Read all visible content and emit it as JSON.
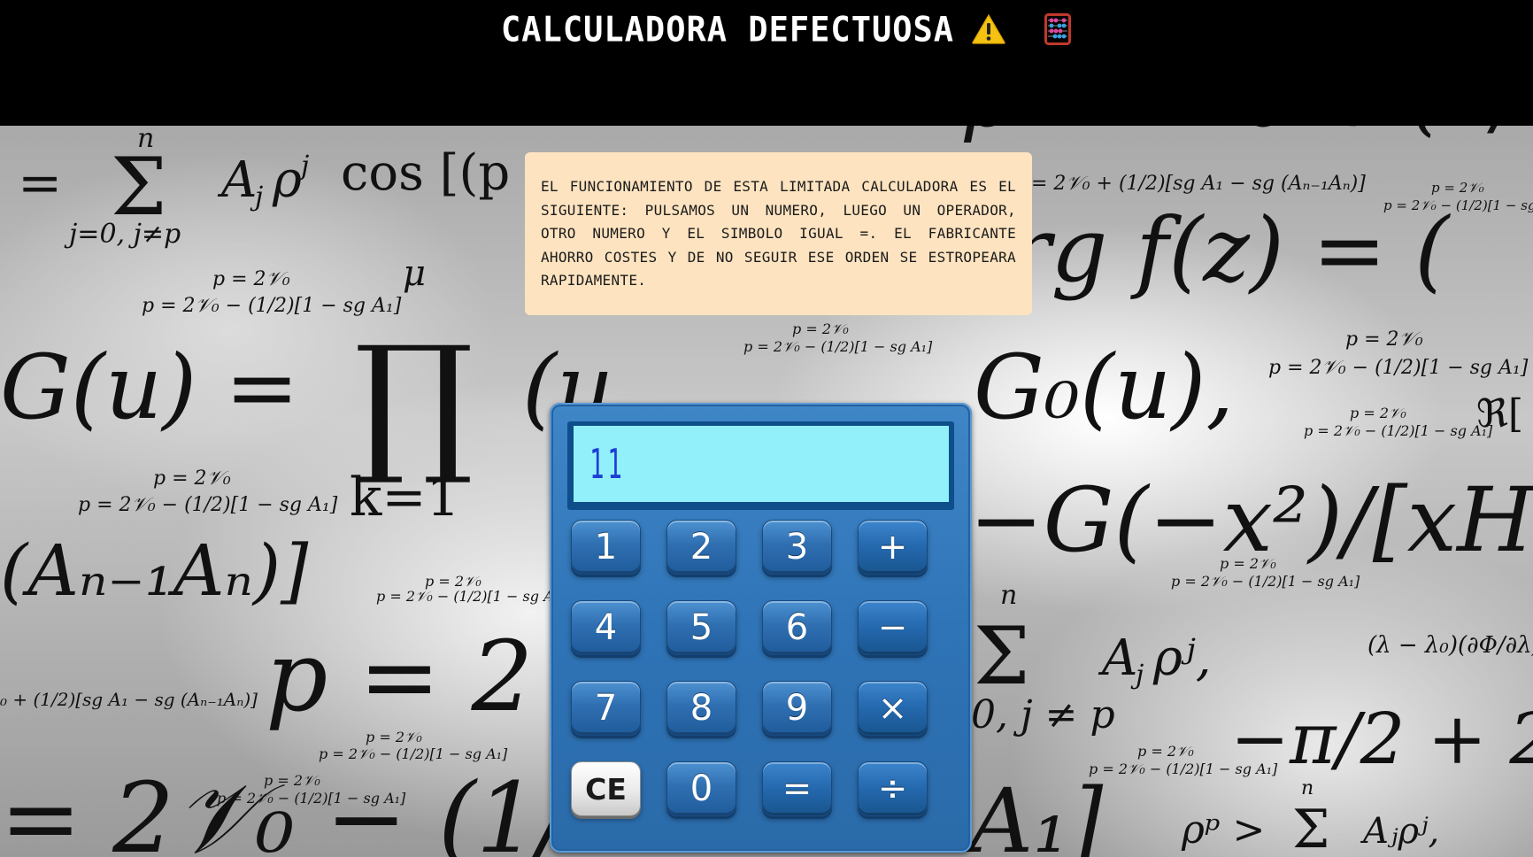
{
  "header": {
    "title": "CALCULADORA DEFECTUOSA",
    "warning_icon": "warning-icon",
    "abacus_icon": "abacus-icon"
  },
  "note": {
    "text": "EL FUNCIONAMIENTO DE ESTA LIMITADA CALCULADORA ES EL SIGUIENTE: PULSAMOS UN NUMERO, LUEGO UN OPERADOR, OTRO NUMERO Y EL SIMBOLO IGUAL =. EL FABRICANTE AHORRO COSTES Y DE NO SEGUIR ESE ORDEN SE ESTROPEARA RAPIDAMENTE."
  },
  "calculator": {
    "display": "11",
    "keys": [
      {
        "label": "1",
        "type": "digit",
        "name": "key-1"
      },
      {
        "label": "2",
        "type": "digit",
        "name": "key-2"
      },
      {
        "label": "3",
        "type": "digit",
        "name": "key-3"
      },
      {
        "label": "+",
        "type": "op",
        "name": "key-plus"
      },
      {
        "label": "4",
        "type": "digit",
        "name": "key-4"
      },
      {
        "label": "5",
        "type": "digit",
        "name": "key-5"
      },
      {
        "label": "6",
        "type": "digit",
        "name": "key-6"
      },
      {
        "label": "−",
        "type": "op",
        "name": "key-minus"
      },
      {
        "label": "7",
        "type": "digit",
        "name": "key-7"
      },
      {
        "label": "8",
        "type": "digit",
        "name": "key-8"
      },
      {
        "label": "9",
        "type": "digit",
        "name": "key-9"
      },
      {
        "label": "×",
        "type": "op",
        "name": "key-multiply"
      },
      {
        "label": "CE",
        "type": "ce",
        "name": "key-clear"
      },
      {
        "label": "0",
        "type": "digit",
        "name": "key-0"
      },
      {
        "label": "=",
        "type": "op",
        "name": "key-equals"
      },
      {
        "label": "÷",
        "type": "op",
        "name": "key-divide"
      }
    ]
  },
  "colors": {
    "header_bg": "#000000",
    "note_bg": "#fde3c0",
    "calc_body": "#2f74b7",
    "screen_bg": "#92f0fa",
    "display_digits": "#1d3fd6"
  }
}
